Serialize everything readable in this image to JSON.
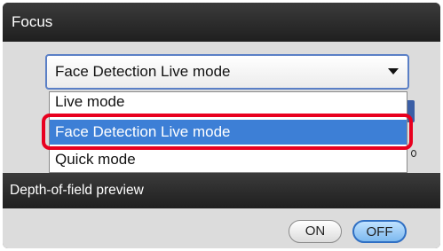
{
  "focus_section": {
    "title": "Focus",
    "dropdown": {
      "selected": "Face Detection Live mode",
      "options": [
        {
          "label": "Live mode",
          "highlighted": false
        },
        {
          "label": "Face Detection Live mode",
          "highlighted": true
        },
        {
          "label": "Quick mode",
          "highlighted": false
        }
      ]
    }
  },
  "depth_of_field_section": {
    "title": "Depth-of-field preview",
    "on_label": "ON",
    "off_label": "OFF",
    "active": "OFF"
  },
  "colors": {
    "header_bg": "#2a2a2a",
    "panel_bg": "#dcdcdc",
    "selection_bg": "#3d7fd6",
    "annotation_ring": "#e8001f",
    "active_toggle": "#7db9ef"
  },
  "icons": {
    "dropdown_arrow": "chevron-down-icon"
  }
}
